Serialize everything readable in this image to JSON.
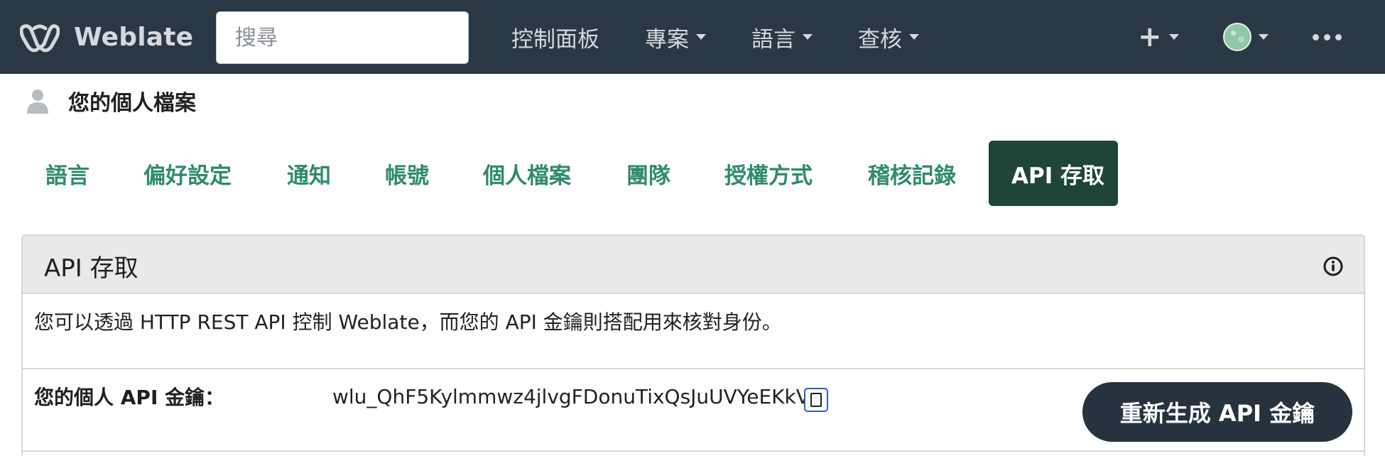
{
  "navbar": {
    "brand": "Weblate",
    "search_placeholder": "搜尋",
    "items": [
      {
        "label": "控制面板"
      },
      {
        "label": "專案"
      },
      {
        "label": "語言"
      },
      {
        "label": "查核"
      }
    ],
    "add_label": "+"
  },
  "profile": {
    "title": "您的個人檔案"
  },
  "tabs": [
    {
      "label": "語言"
    },
    {
      "label": "偏好設定"
    },
    {
      "label": "通知"
    },
    {
      "label": "帳號"
    },
    {
      "label": "個人檔案"
    },
    {
      "label": "團隊"
    },
    {
      "label": "授權方式"
    },
    {
      "label": "稽核記錄"
    },
    {
      "label": "API 存取",
      "active": true
    }
  ],
  "api_card": {
    "title": "API 存取",
    "description": "您可以透過 HTTP REST API 控制 Weblate，而您的 API 金鑰則搭配用來核對身份。",
    "key_label": "您的個人 API 金鑰：",
    "key_value": "wlu_QhF5Kylmmwz4jlvgFDonuTixQsJuUVYeEKkV",
    "regenerate_label": "重新生成 API 金鑰"
  },
  "colors": {
    "navbar_bg": "#2a3744",
    "tab_text": "#2f8a6e",
    "tab_active_bg": "#1f4537",
    "button_bg": "#26333f",
    "copy_border": "#2d5fc4"
  },
  "icons": {
    "brand": "weblate-logo-icon",
    "user": "user-icon",
    "info": "info-icon",
    "copy": "copy-icon",
    "more": "more-dots-icon"
  }
}
